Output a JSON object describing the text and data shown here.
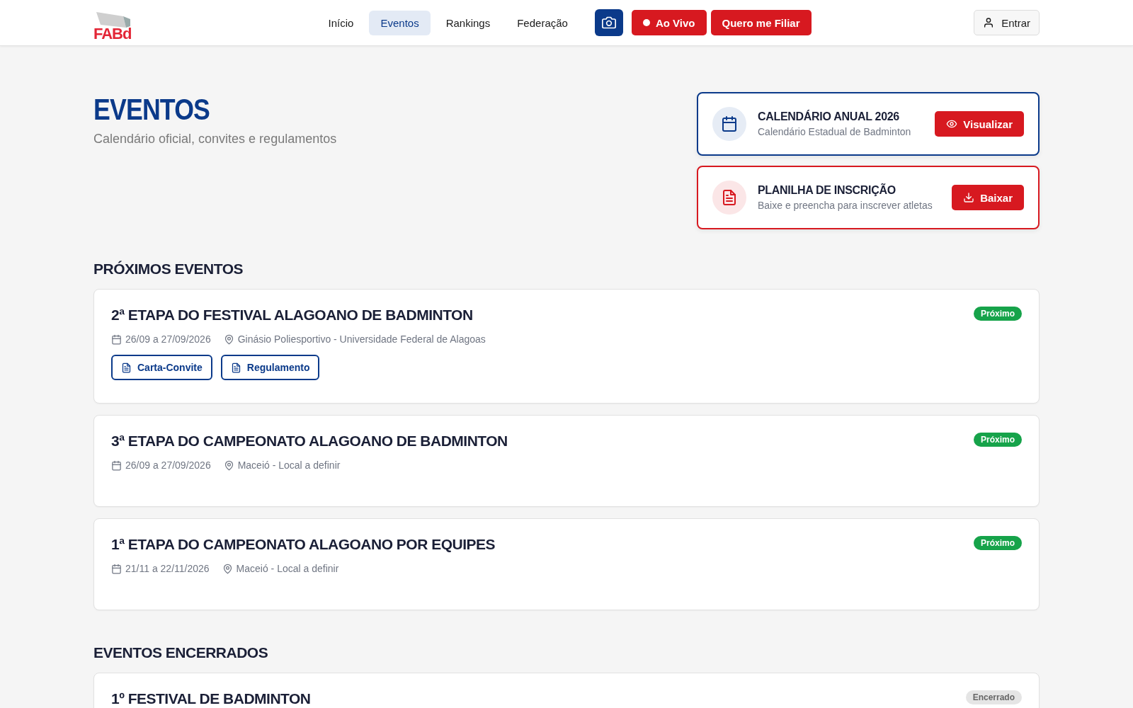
{
  "header": {
    "logo": "FABd",
    "nav": [
      {
        "label": "Início",
        "selected": false
      },
      {
        "label": "Eventos",
        "selected": true
      },
      {
        "label": "Rankings",
        "selected": false
      },
      {
        "label": "Federação",
        "selected": false
      }
    ],
    "live_button": "Ao Vivo",
    "join_button": "Quero me Filiar",
    "login_button": "Entrar"
  },
  "page": {
    "title": "EVENTOS",
    "subtitle": "Calendário oficial, convites e regulamentos"
  },
  "resources": [
    {
      "kind": "calendar",
      "title": "CALENDÁRIO ANUAL 2026",
      "subtitle": "Calendário Estadual de Badminton",
      "action": "Visualizar"
    },
    {
      "kind": "sheet",
      "title": "PLANILHA DE INSCRIÇÃO",
      "subtitle": "Baixe e preencha para inscrever atletas",
      "action": "Baixar"
    }
  ],
  "sections": [
    {
      "title": "PRÓXIMOS EVENTOS",
      "events": [
        {
          "title": "2ª ETAPA DO FESTIVAL ALAGOANO DE BADMINTON",
          "kind": "upcoming",
          "badge": "Próximo",
          "date": "26/09 a 27/09/2026",
          "place": "Ginásio Poliesportivo - Universidade Federal de Alagoas",
          "documents": [
            "Carta-Convite",
            "Regulamento"
          ]
        },
        {
          "title": "3ª ETAPA DO CAMPEONATO ALAGOANO DE BADMINTON",
          "kind": "upcoming",
          "badge": "Próximo",
          "date": "26/09 a 27/09/2026",
          "place": "Maceió - Local a definir"
        },
        {
          "title": "1ª ETAPA DO CAMPEONATO ALAGOANO POR EQUIPES",
          "kind": "upcoming",
          "badge": "Próximo",
          "date": "21/11 a 22/11/2026",
          "place": "Maceió - Local a definir"
        }
      ]
    },
    {
      "title": "EVENTOS ENCERRADOS",
      "events": [
        {
          "title": "1º FESTIVAL DE BADMINTON",
          "kind": "ended",
          "badge": "Encerrado"
        }
      ]
    }
  ]
}
